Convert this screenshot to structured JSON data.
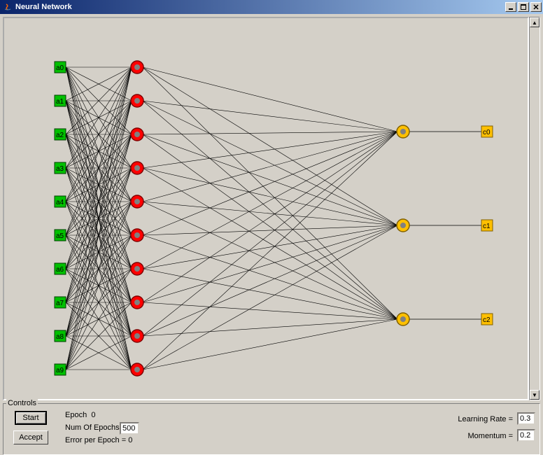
{
  "window": {
    "title": "Neural Network"
  },
  "controls": {
    "groupLabel": "Controls",
    "startLabel": "Start",
    "acceptLabel": "Accept",
    "epochLabel": "Epoch",
    "epochValue": "0",
    "numEpochsLabel": "Num Of Epochs",
    "numEpochsValue": "500",
    "errorLabel": "Error per Epoch =",
    "errorValue": "0",
    "learningRateLabel": "Learning Rate =",
    "learningRateValue": "0.3",
    "momentumLabel": "Momentum =",
    "momentumValue": "0.2"
  },
  "network": {
    "inputs": [
      {
        "id": "a0",
        "label": "a0"
      },
      {
        "id": "a1",
        "label": "a1"
      },
      {
        "id": "a2",
        "label": "a2"
      },
      {
        "id": "a3",
        "label": "a3"
      },
      {
        "id": "a4",
        "label": "a4"
      },
      {
        "id": "a5",
        "label": "a5"
      },
      {
        "id": "a6",
        "label": "a6"
      },
      {
        "id": "a7",
        "label": "a7"
      },
      {
        "id": "a8",
        "label": "a8"
      },
      {
        "id": "a9",
        "label": "a9"
      }
    ],
    "hiddenCount": 10,
    "outputs": [
      {
        "id": "c0",
        "label": "c0"
      },
      {
        "id": "c1",
        "label": "c1"
      },
      {
        "id": "c2",
        "label": "c2"
      }
    ],
    "colors": {
      "input": "#00c000",
      "hidden": "#ff0000",
      "hiddenInner": "#808080",
      "output": "#ffc000",
      "outputInner": "#808080",
      "outputBox": "#ffc000",
      "edge": "#000000"
    },
    "layout": {
      "inputX": 80,
      "hiddenX": 190,
      "outputNodeX": 570,
      "outputBoxX": 690,
      "topY": 70,
      "spacingInput": 48,
      "hiddenTopY": 70,
      "hiddenSpacing": 48,
      "outputYs": [
        162,
        296,
        430
      ]
    }
  }
}
